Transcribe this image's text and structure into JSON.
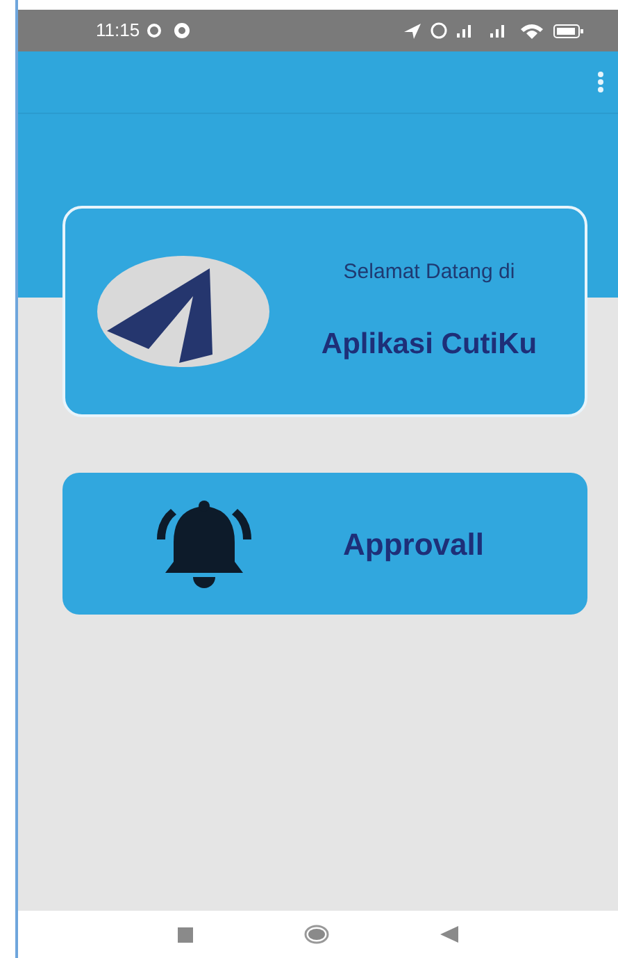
{
  "status_bar": {
    "time": "11:15"
  },
  "welcome_card": {
    "greeting": "Selamat Datang di",
    "app_name": "Aplikasi CutiKu"
  },
  "menu_cards": [
    {
      "kind": "bell",
      "label": "Approvall"
    }
  ]
}
